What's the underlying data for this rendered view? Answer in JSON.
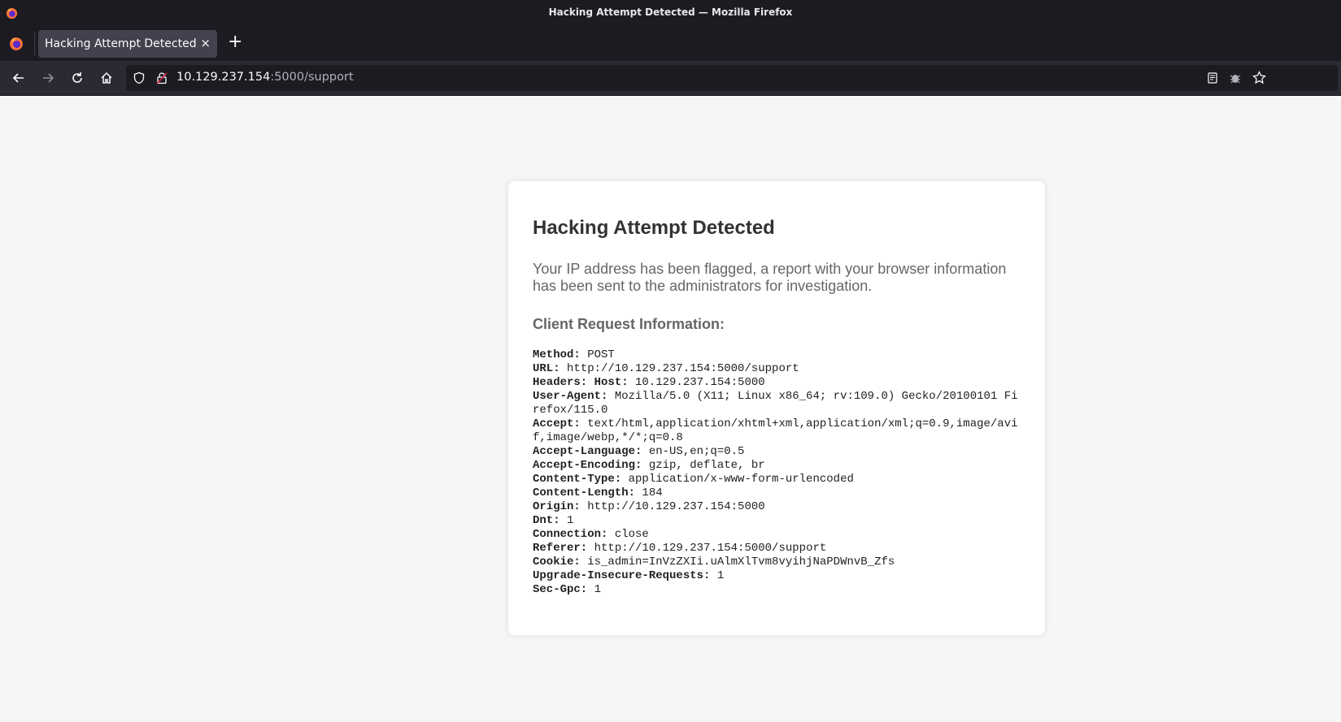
{
  "window": {
    "title": "Hacking Attempt Detected — Mozilla Firefox"
  },
  "tab": {
    "title": "Hacking Attempt Detected",
    "close": "×",
    "new_tab": "+"
  },
  "address": {
    "host": "10.129.237.154",
    "rest": ":5000/support"
  },
  "page": {
    "heading": "Hacking Attempt Detected",
    "message": "Your IP address has been flagged, a report with your browser information has been sent to the administrators for investigation.",
    "subheading": "Client Request Information:",
    "fields": [
      {
        "key": "Method:",
        "value": " POST"
      },
      {
        "key": "URL:",
        "value": " http://10.129.237.154:5000/support"
      },
      {
        "key": "Headers: Host:",
        "value": " 10.129.237.154:5000"
      },
      {
        "key": "User-Agent:",
        "value": " Mozilla/5.0 (X11; Linux x86_64; rv:109.0) Gecko/20100101 Firefox/115.0"
      },
      {
        "key": "Accept:",
        "value": " text/html,application/xhtml+xml,application/xml;q=0.9,image/avif,image/webp,*/*;q=0.8"
      },
      {
        "key": "Accept-Language:",
        "value": " en-US,en;q=0.5"
      },
      {
        "key": "Accept-Encoding:",
        "value": " gzip, deflate, br"
      },
      {
        "key": "Content-Type:",
        "value": " application/x-www-form-urlencoded"
      },
      {
        "key": "Content-Length:",
        "value": " 184"
      },
      {
        "key": "Origin:",
        "value": " http://10.129.237.154:5000"
      },
      {
        "key": "Dnt:",
        "value": " 1"
      },
      {
        "key": "Connection:",
        "value": " close"
      },
      {
        "key": "Referer:",
        "value": " http://10.129.237.154:5000/support"
      },
      {
        "key": "Cookie:",
        "value": " is_admin=InVzZXIi.uAlmXlTvm8vyihjNaPDWnvB_Zfs"
      },
      {
        "key": "Upgrade-Insecure-Requests:",
        "value": " 1"
      },
      {
        "key": "Sec-Gpc:",
        "value": " 1"
      }
    ]
  }
}
